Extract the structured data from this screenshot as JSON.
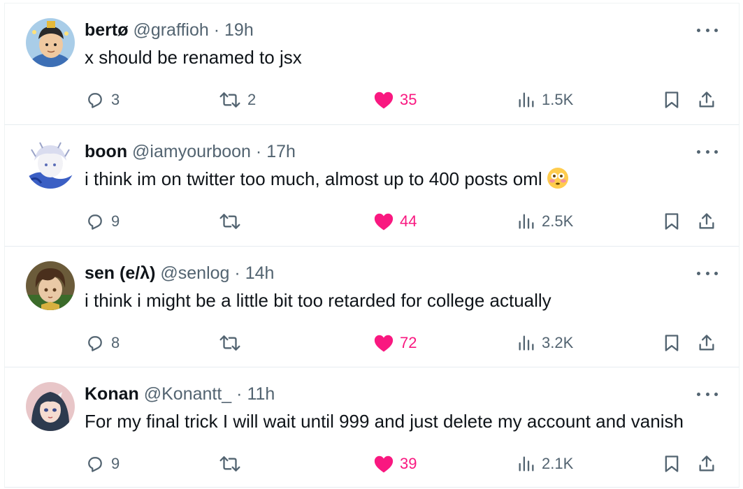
{
  "tweets": [
    {
      "name": "bertø",
      "handle": "@graffioh",
      "time": "19h",
      "text": "x should be renamed to jsx",
      "replies": "3",
      "retweets": "2",
      "likes": "35",
      "views": "1.5K",
      "avatar": "cartoon-boy-avatar"
    },
    {
      "name": "boon",
      "handle": "@iamyourboon",
      "time": "17h",
      "text": "i think im on twitter too much, almost up to 400 posts oml",
      "emoji": "flushed-face-emoji",
      "replies": "9",
      "retweets": "",
      "likes": "44",
      "views": "2.5K",
      "avatar": "white-haired-anime-avatar"
    },
    {
      "name": "sen (e/λ)",
      "handle": "@senlog",
      "time": "14h",
      "text": "i think i might be a little bit too retarded for college actually",
      "replies": "8",
      "retweets": "",
      "likes": "72",
      "views": "3.2K",
      "avatar": "brown-haired-anime-avatar"
    },
    {
      "name": "Konan",
      "handle": "@Konantt_",
      "time": "11h",
      "text": "For my final trick I will wait until 999 and just delete my account and vanish",
      "replies": "9",
      "retweets": "",
      "likes": "39",
      "views": "2.1K",
      "avatar": "dark-haired-anime-girl-avatar"
    }
  ],
  "colors": {
    "like": "#f91880",
    "muted": "#536471",
    "text": "#0f1419",
    "divider": "#e6ecf0"
  },
  "separator": "·"
}
